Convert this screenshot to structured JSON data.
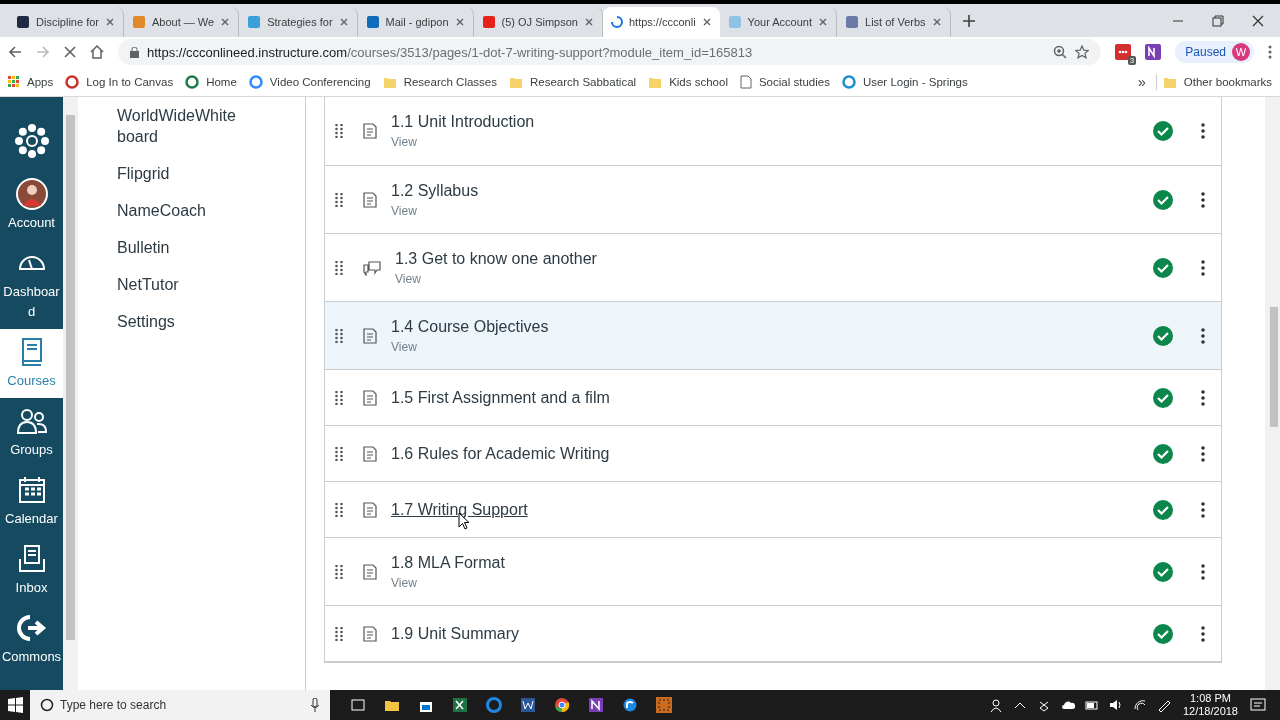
{
  "browser": {
    "tabs": [
      {
        "title": "Discipline for",
        "kind": "favicon",
        "color": "#1f2a44",
        "selected": false
      },
      {
        "title": "About — We",
        "kind": "favicon",
        "color": "#e0892b",
        "selected": false
      },
      {
        "title": "Strategies for",
        "kind": "favicon",
        "color": "#3aa0d8",
        "selected": false
      },
      {
        "title": "Mail - gdipon",
        "kind": "favicon",
        "color": "#0f6cbd",
        "selected": false
      },
      {
        "title": "(5) OJ Simpson",
        "kind": "favicon",
        "color": "#e62117",
        "selected": false
      },
      {
        "title": "https://ccconli",
        "kind": "loading",
        "color": "#1a73e8",
        "selected": true
      },
      {
        "title": "Your Account",
        "kind": "favicon",
        "color": "#8fc3e6",
        "selected": false
      },
      {
        "title": "List of Verbs",
        "kind": "favicon",
        "color": "#6c7aa8",
        "selected": false
      }
    ],
    "url_origin": "https://ccconlineed.instructure.com",
    "url_path": "/courses/3513/pages/1-dot-7-writing-support?module_item_id=165813",
    "extension_badge": "3",
    "profile_status": "Paused",
    "profile_initial": "W",
    "bookmarks": [
      {
        "label": "Apps",
        "kind": "apps"
      },
      {
        "label": "Log In to Canvas",
        "kind": "site",
        "color": "#c8322c"
      },
      {
        "label": "Home",
        "kind": "site",
        "color": "#1b7a4a"
      },
      {
        "label": "Video Conferencing",
        "kind": "site",
        "color": "#2d8cff"
      },
      {
        "label": "Research Classes",
        "kind": "folder"
      },
      {
        "label": "Research Sabbatical",
        "kind": "folder"
      },
      {
        "label": "Kids school",
        "kind": "folder"
      },
      {
        "label": "Social studies",
        "kind": "page"
      },
      {
        "label": "User Login - Springs",
        "kind": "site",
        "color": "#1a8fd0"
      }
    ],
    "overflow": "»",
    "other_bookmarks": "Other bookmarks"
  },
  "global_nav": [
    {
      "label": "Account",
      "kind": "account",
      "selected": false
    },
    {
      "label": "Dashboard",
      "kind": "dashboard",
      "selected": false
    },
    {
      "label": "Courses",
      "kind": "courses",
      "selected": true
    },
    {
      "label": "Groups",
      "kind": "groups",
      "selected": false
    },
    {
      "label": "Calendar",
      "kind": "calendar",
      "selected": false
    },
    {
      "label": "Inbox",
      "kind": "inbox",
      "selected": false
    },
    {
      "label": "Commons",
      "kind": "commons",
      "selected": false
    }
  ],
  "course_nav": [
    "WorldWideWhiteboard",
    "Flipgrid",
    "NameCoach",
    "Bulletin",
    "NetTutor",
    "Settings"
  ],
  "module_items": [
    {
      "title": "1.1 Unit Introduction",
      "kind": "page",
      "subtitle": "View",
      "published": true,
      "highlighted": false,
      "underlined": false
    },
    {
      "title": "1.2 Syllabus",
      "kind": "page",
      "subtitle": "View",
      "published": true,
      "highlighted": false,
      "underlined": false
    },
    {
      "title": "1.3 Get to know one another",
      "kind": "discussion",
      "subtitle": "View",
      "published": true,
      "highlighted": false,
      "underlined": false
    },
    {
      "title": "1.4 Course Objectives",
      "kind": "page",
      "subtitle": "View",
      "published": true,
      "highlighted": true,
      "underlined": false
    },
    {
      "title": "1.5 First Assignment and a film",
      "kind": "page",
      "published": true,
      "highlighted": false,
      "underlined": false
    },
    {
      "title": "1.6 Rules for Academic Writing",
      "kind": "page",
      "published": true,
      "highlighted": false,
      "underlined": false
    },
    {
      "title": "1.7 Writing Support",
      "kind": "page",
      "published": true,
      "highlighted": false,
      "underlined": true
    },
    {
      "title": "1.8 MLA Format",
      "kind": "page",
      "subtitle": "View",
      "published": true,
      "highlighted": false,
      "underlined": false
    },
    {
      "title": "1.9 Unit Summary",
      "kind": "page",
      "published": true,
      "highlighted": false,
      "underlined": false
    }
  ],
  "taskbar": {
    "search_placeholder": "Type here to search",
    "time": "1:08 PM",
    "date": "12/18/2018"
  }
}
